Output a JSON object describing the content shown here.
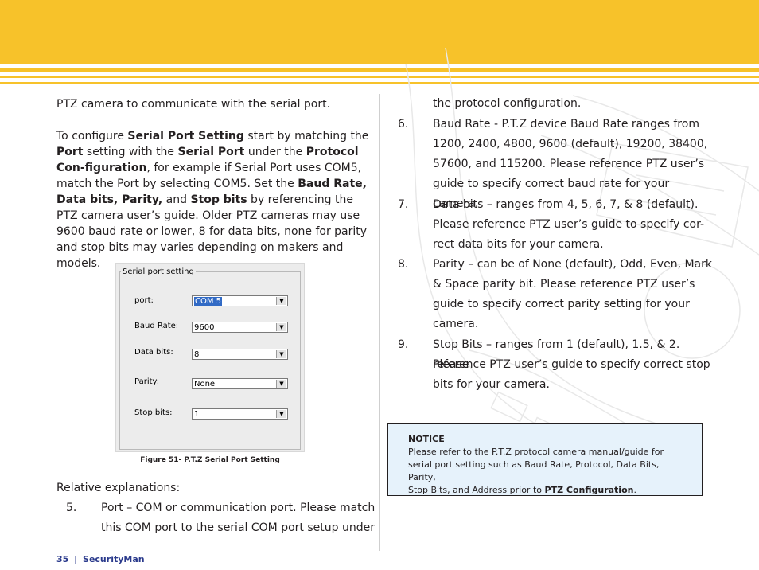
{
  "left": {
    "intro": "PTZ camera to communicate with the serial port.",
    "para2": {
      "s1": "To configure ",
      "b1": "Serial Port Setting",
      "s2": " start by matching the ",
      "b2": "Port",
      "s3": " setting with the ",
      "b3": "Serial Port",
      "s4": " under the ",
      "b4": "Protocol Con-figuration",
      "s5": ", for example if Serial Port uses COM5, match the Port by selecting COM5.  Set the ",
      "b5": "Baud Rate, Data bits, Parity,",
      "s6": " and ",
      "b6": "Stop bits",
      "s7": " by referencing the PTZ camera user’s guide.  Older PTZ cameras may use 9600 baud rate or lower, 8 for data bits, none for parity and stop bits may varies depending on makers and models."
    },
    "relative_title": "Relative explanations:",
    "item5": {
      "num": "5.",
      "line1": "Port – COM or communication port.  Please match",
      "line2": "this COM port to the serial COM port setup under"
    }
  },
  "serial_dialog": {
    "group_title": "Serial port setting",
    "fields": [
      {
        "label": "port:",
        "value": "COM 5"
      },
      {
        "label": "Baud Rate:",
        "value": "9600"
      },
      {
        "label": "Data bits:",
        "value": "8"
      },
      {
        "label": "Parity:",
        "value": "None"
      },
      {
        "label": "Stop bits:",
        "value": "1"
      }
    ],
    "dropdown_glyph": "▼"
  },
  "figure_caption": "Figure 51- P.T.Z Serial Port Setting",
  "right": {
    "continuation": "the protocol configuration.",
    "items": [
      {
        "num": "6.",
        "lines": [
          "Baud Rate - P.T.Z device Baud Rate ranges from",
          "1200, 2400, 4800, 9600 (default), 19200, 38400,",
          "57600, and 115200. Please reference PTZ user’s",
          "guide to specify correct baud rate for your camera."
        ]
      },
      {
        "num": "7.",
        "lines": [
          "Data bits – ranges from 4, 5, 6, 7, & 8 (default).",
          "Please reference PTZ user’s guide to specify cor-",
          "rect data bits for your camera."
        ]
      },
      {
        "num": "8.",
        "lines": [
          "Parity – can be of None (default), Odd, Even, Mark",
          "& Space parity bit. Please reference PTZ user’s",
          "guide to specify correct parity setting for your",
          "camera."
        ]
      },
      {
        "num": "9.",
        "lines": [
          "Stop Bits – ranges from 1 (default), 1.5, & 2.  Please",
          "reference PTZ user’s guide to specify correct stop",
          "bits for your camera."
        ]
      }
    ]
  },
  "notice": {
    "title": "NOTICE",
    "line1": "Please refer to the P.T.Z protocol camera manual/guide for",
    "line2": "serial port setting such as Baud Rate, Protocol, Data Bits, Parity,",
    "line3_pre": "Stop Bits, and Address prior to ",
    "line3_bold": "PTZ Configuration",
    "line3_post": "."
  },
  "footer": {
    "page_number": "35",
    "separator": "|",
    "brand": "SecurityMan"
  },
  "colors": {
    "header": "#f7c22a",
    "notice_bg": "#e6f2fb",
    "footer_text": "#2a3a8c"
  }
}
